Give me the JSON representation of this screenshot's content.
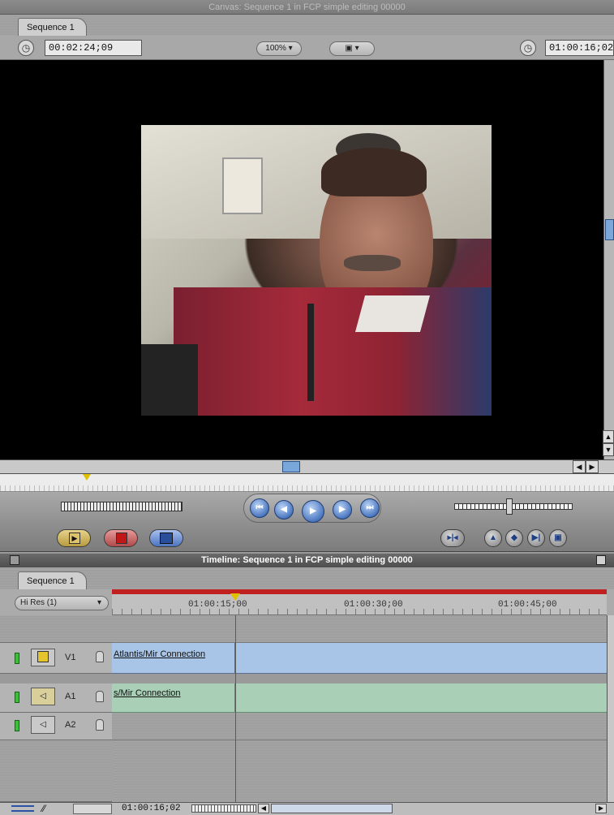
{
  "canvas": {
    "title": "Canvas: Sequence 1 in FCP simple editing 00000",
    "tab": "Sequence 1",
    "duration_timecode": "00:02:24;09",
    "zoom": "100%",
    "view_mode_icon": "frame-icon",
    "current_timecode": "01:00:16;02",
    "video_description": "astronaut-interview-frame"
  },
  "editbar": {
    "overwrite_icon": "insert-icon",
    "mark_icon": "marker-icon",
    "replace_icon": "overlay-icon",
    "transport_right": [
      "mark-in",
      "add-marker",
      "mark-clip",
      "mark-out",
      "match-frame"
    ]
  },
  "transport": {
    "buttons": [
      "go-to-in",
      "prev-edit",
      "play",
      "next-edit",
      "go-to-out"
    ],
    "glyphs": [
      "⏮",
      "◀",
      "▶",
      "▶",
      "⏭"
    ]
  },
  "timeline": {
    "title": "Timeline: Sequence 1 in FCP simple editing 00000",
    "tab": "Sequence 1",
    "resolution": "Hi Res (1)",
    "ruler_labels": [
      "01:00:15;00",
      "01:00:30;00",
      "01:00:45;00"
    ],
    "tracks": [
      {
        "name": "V1",
        "type": "video",
        "clip": "Atlantis/Mir Connection"
      },
      {
        "name": "A1",
        "type": "audio",
        "clip": "s/Mir Connection"
      },
      {
        "name": "A2",
        "type": "audio",
        "clip": ""
      }
    ],
    "bottom_timecode": "01:00:16;02"
  },
  "colors": {
    "video_clip": "#a8c4e6",
    "audio_clip": "#a9cfb6",
    "playhead": "#e0c000",
    "ruler_bar": "#c02020"
  }
}
